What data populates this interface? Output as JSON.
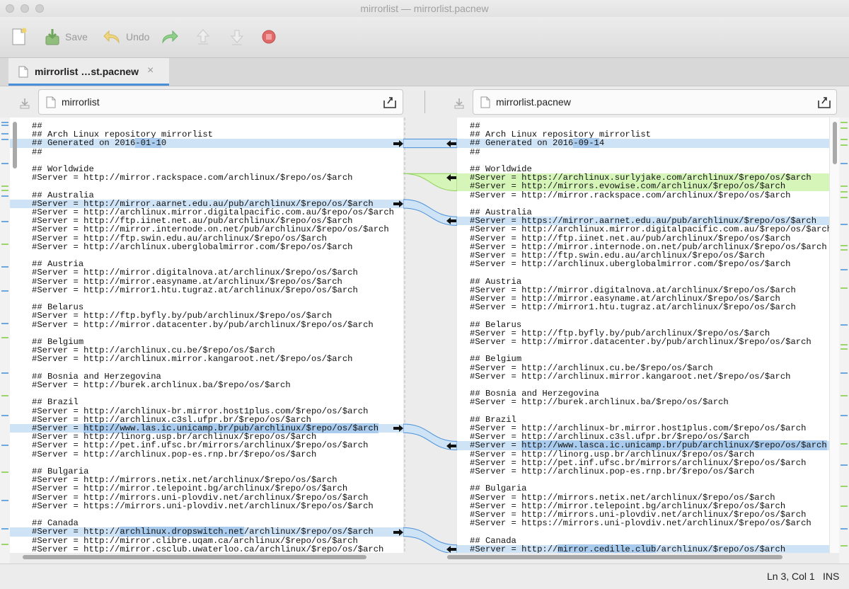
{
  "window": {
    "title": "mirrorlist — mirrorlist.pacnew"
  },
  "toolbar": {
    "save_label": "Save",
    "undo_label": "Undo"
  },
  "tab": {
    "label": "mirrorlist …st.pacnew",
    "close": "×"
  },
  "files": {
    "left": "mirrorlist",
    "right": "mirrorlist.pacnew"
  },
  "status": {
    "position": "Ln 3, Col 1",
    "mode": "INS"
  },
  "colors": {
    "changed": "#cfe3f7",
    "inserted": "#d6f5b8",
    "inline_change": "#a8cbee",
    "tab_accent": "#4a90d9"
  },
  "left_lines": [
    {
      "t": "##",
      "s": ""
    },
    {
      "t": "## Arch Linux repository mirrorlist",
      "s": ""
    },
    {
      "t": "## Generated on 2016-01-10",
      "s": "blue",
      "h": [
        [
          20,
          25
        ]
      ]
    },
    {
      "t": "##",
      "s": ""
    },
    {
      "t": "",
      "s": ""
    },
    {
      "t": "## Worldwide",
      "s": ""
    },
    {
      "t": "#Server = http://mirror.rackspace.com/archlinux/$repo/os/$arch",
      "s": ""
    },
    {
      "t": "",
      "s": ""
    },
    {
      "t": "## Australia",
      "s": ""
    },
    {
      "t": "#Server = http://mirror.aarnet.edu.au/pub/archlinux/$repo/os/$arch",
      "s": "blue"
    },
    {
      "t": "#Server = http://archlinux.mirror.digitalpacific.com.au/$repo/os/$arch",
      "s": ""
    },
    {
      "t": "#Server = http://ftp.iinet.net.au/pub/archlinux/$repo/os/$arch",
      "s": ""
    },
    {
      "t": "#Server = http://mirror.internode.on.net/pub/archlinux/$repo/os/$arch",
      "s": ""
    },
    {
      "t": "#Server = http://ftp.swin.edu.au/archlinux/$repo/os/$arch",
      "s": ""
    },
    {
      "t": "#Server = http://archlinux.uberglobalmirror.com/$repo/os/$arch",
      "s": ""
    },
    {
      "t": "",
      "s": ""
    },
    {
      "t": "## Austria",
      "s": ""
    },
    {
      "t": "#Server = http://mirror.digitalnova.at/archlinux/$repo/os/$arch",
      "s": ""
    },
    {
      "t": "#Server = http://mirror.easyname.at/archlinux/$repo/os/$arch",
      "s": ""
    },
    {
      "t": "#Server = http://mirror1.htu.tugraz.at/archlinux/$repo/os/$arch",
      "s": ""
    },
    {
      "t": "",
      "s": ""
    },
    {
      "t": "## Belarus",
      "s": ""
    },
    {
      "t": "#Server = http://ftp.byfly.by/pub/archlinux/$repo/os/$arch",
      "s": ""
    },
    {
      "t": "#Server = http://mirror.datacenter.by/pub/archlinux/$repo/os/$arch",
      "s": ""
    },
    {
      "t": "",
      "s": ""
    },
    {
      "t": "## Belgium",
      "s": ""
    },
    {
      "t": "#Server = http://archlinux.cu.be/$repo/os/$arch",
      "s": ""
    },
    {
      "t": "#Server = http://archlinux.mirror.kangaroot.net/$repo/os/$arch",
      "s": ""
    },
    {
      "t": "",
      "s": ""
    },
    {
      "t": "## Bosnia and Herzegovina",
      "s": ""
    },
    {
      "t": "#Server = http://burek.archlinux.ba/$repo/os/$arch",
      "s": ""
    },
    {
      "t": "",
      "s": ""
    },
    {
      "t": "## Brazil",
      "s": ""
    },
    {
      "t": "#Server = http://archlinux-br.mirror.host1plus.com/$repo/os/$arch",
      "s": ""
    },
    {
      "t": "#Server = http://archlinux.c3sl.ufpr.br/$repo/os/$arch",
      "s": ""
    },
    {
      "t": "#Server = http://www.las.ic.unicamp.br/pub/archlinux/$repo/os/$arch",
      "s": "blue",
      "h": [
        [
          10,
          68
        ]
      ]
    },
    {
      "t": "#Server = http://linorg.usp.br/archlinux/$repo/os/$arch",
      "s": ""
    },
    {
      "t": "#Server = http://pet.inf.ufsc.br/mirrors/archlinux/$repo/os/$arch",
      "s": ""
    },
    {
      "t": "#Server = http://archlinux.pop-es.rnp.br/$repo/os/$arch",
      "s": ""
    },
    {
      "t": "",
      "s": ""
    },
    {
      "t": "## Bulgaria",
      "s": ""
    },
    {
      "t": "#Server = http://mirrors.netix.net/archlinux/$repo/os/$arch",
      "s": ""
    },
    {
      "t": "#Server = http://mirror.telepoint.bg/archlinux/$repo/os/$arch",
      "s": ""
    },
    {
      "t": "#Server = http://mirrors.uni-plovdiv.net/archlinux/$repo/os/$arch",
      "s": ""
    },
    {
      "t": "#Server = https://mirrors.uni-plovdiv.net/archlinux/$repo/os/$arch",
      "s": ""
    },
    {
      "t": "",
      "s": ""
    },
    {
      "t": "## Canada",
      "s": ""
    },
    {
      "t": "#Server = http://archlinux.dropswitch.net/archlinux/$repo/os/$arch",
      "s": "blue",
      "h": [
        [
          17,
          41
        ]
      ]
    },
    {
      "t": "#Server = http://mirror.clibre.uqam.ca/archlinux/$repo/os/$arch",
      "s": ""
    },
    {
      "t": "#Server = http://mirror.csclub.uwaterloo.ca/archlinux/$repo/os/$arch",
      "s": ""
    }
  ],
  "right_lines": [
    {
      "t": "##",
      "s": ""
    },
    {
      "t": "## Arch Linux repository mirrorlist",
      "s": ""
    },
    {
      "t": "## Generated on 2016-09-14",
      "s": "blue",
      "h": [
        [
          20,
          25
        ]
      ]
    },
    {
      "t": "##",
      "s": ""
    },
    {
      "t": "",
      "s": ""
    },
    {
      "t": "## Worldwide",
      "s": ""
    },
    {
      "t": "#Server = https://archlinux.surlyjake.com/archlinux/$repo/os/$arch",
      "s": "green"
    },
    {
      "t": "#Server = http://mirrors.evowise.com/archlinux/$repo/os/$arch",
      "s": "green"
    },
    {
      "t": "#Server = http://mirror.rackspace.com/archlinux/$repo/os/$arch",
      "s": ""
    },
    {
      "t": "",
      "s": ""
    },
    {
      "t": "## Australia",
      "s": ""
    },
    {
      "t": "#Server = https://mirror.aarnet.edu.au/pub/archlinux/$repo/os/$arch",
      "s": "blue"
    },
    {
      "t": "#Server = http://archlinux.mirror.digitalpacific.com.au/$repo/os/$arch",
      "s": ""
    },
    {
      "t": "#Server = http://ftp.iinet.net.au/pub/archlinux/$repo/os/$arch",
      "s": ""
    },
    {
      "t": "#Server = http://mirror.internode.on.net/pub/archlinux/$repo/os/$arch",
      "s": ""
    },
    {
      "t": "#Server = http://ftp.swin.edu.au/archlinux/$repo/os/$arch",
      "s": ""
    },
    {
      "t": "#Server = http://archlinux.uberglobalmirror.com/$repo/os/$arch",
      "s": ""
    },
    {
      "t": "",
      "s": ""
    },
    {
      "t": "## Austria",
      "s": ""
    },
    {
      "t": "#Server = http://mirror.digitalnova.at/archlinux/$repo/os/$arch",
      "s": ""
    },
    {
      "t": "#Server = http://mirror.easyname.at/archlinux/$repo/os/$arch",
      "s": ""
    },
    {
      "t": "#Server = http://mirror1.htu.tugraz.at/archlinux/$repo/os/$arch",
      "s": ""
    },
    {
      "t": "",
      "s": ""
    },
    {
      "t": "## Belarus",
      "s": ""
    },
    {
      "t": "#Server = http://ftp.byfly.by/pub/archlinux/$repo/os/$arch",
      "s": ""
    },
    {
      "t": "#Server = http://mirror.datacenter.by/pub/archlinux/$repo/os/$arch",
      "s": ""
    },
    {
      "t": "",
      "s": ""
    },
    {
      "t": "## Belgium",
      "s": ""
    },
    {
      "t": "#Server = http://archlinux.cu.be/$repo/os/$arch",
      "s": ""
    },
    {
      "t": "#Server = http://archlinux.mirror.kangaroot.net/$repo/os/$arch",
      "s": ""
    },
    {
      "t": "",
      "s": ""
    },
    {
      "t": "## Bosnia and Herzegovina",
      "s": ""
    },
    {
      "t": "#Server = http://burek.archlinux.ba/$repo/os/$arch",
      "s": ""
    },
    {
      "t": "",
      "s": ""
    },
    {
      "t": "## Brazil",
      "s": ""
    },
    {
      "t": "#Server = http://archlinux-br.mirror.host1plus.com/$repo/os/$arch",
      "s": ""
    },
    {
      "t": "#Server = http://archlinux.c3sl.ufpr.br/$repo/os/$arch",
      "s": ""
    },
    {
      "t": "#Server = http://www.lasca.ic.unicamp.br/pub/archlinux/$repo/os/$arch",
      "s": "blue",
      "h": [
        [
          10,
          70
        ]
      ]
    },
    {
      "t": "#Server = http://linorg.usp.br/archlinux/$repo/os/$arch",
      "s": ""
    },
    {
      "t": "#Server = http://pet.inf.ufsc.br/mirrors/archlinux/$repo/os/$arch",
      "s": ""
    },
    {
      "t": "#Server = http://archlinux.pop-es.rnp.br/$repo/os/$arch",
      "s": ""
    },
    {
      "t": "",
      "s": ""
    },
    {
      "t": "## Bulgaria",
      "s": ""
    },
    {
      "t": "#Server = http://mirrors.netix.net/archlinux/$repo/os/$arch",
      "s": ""
    },
    {
      "t": "#Server = http://mirror.telepoint.bg/archlinux/$repo/os/$arch",
      "s": ""
    },
    {
      "t": "#Server = http://mirrors.uni-plovdiv.net/archlinux/$repo/os/$arch",
      "s": ""
    },
    {
      "t": "#Server = https://mirrors.uni-plovdiv.net/archlinux/$repo/os/$arch",
      "s": ""
    },
    {
      "t": "",
      "s": ""
    },
    {
      "t": "## Canada",
      "s": ""
    },
    {
      "t": "#Server = http://mirror.cedille.club/archlinux/$repo/os/$arch",
      "s": "blue",
      "h": [
        [
          17,
          36
        ]
      ]
    }
  ]
}
